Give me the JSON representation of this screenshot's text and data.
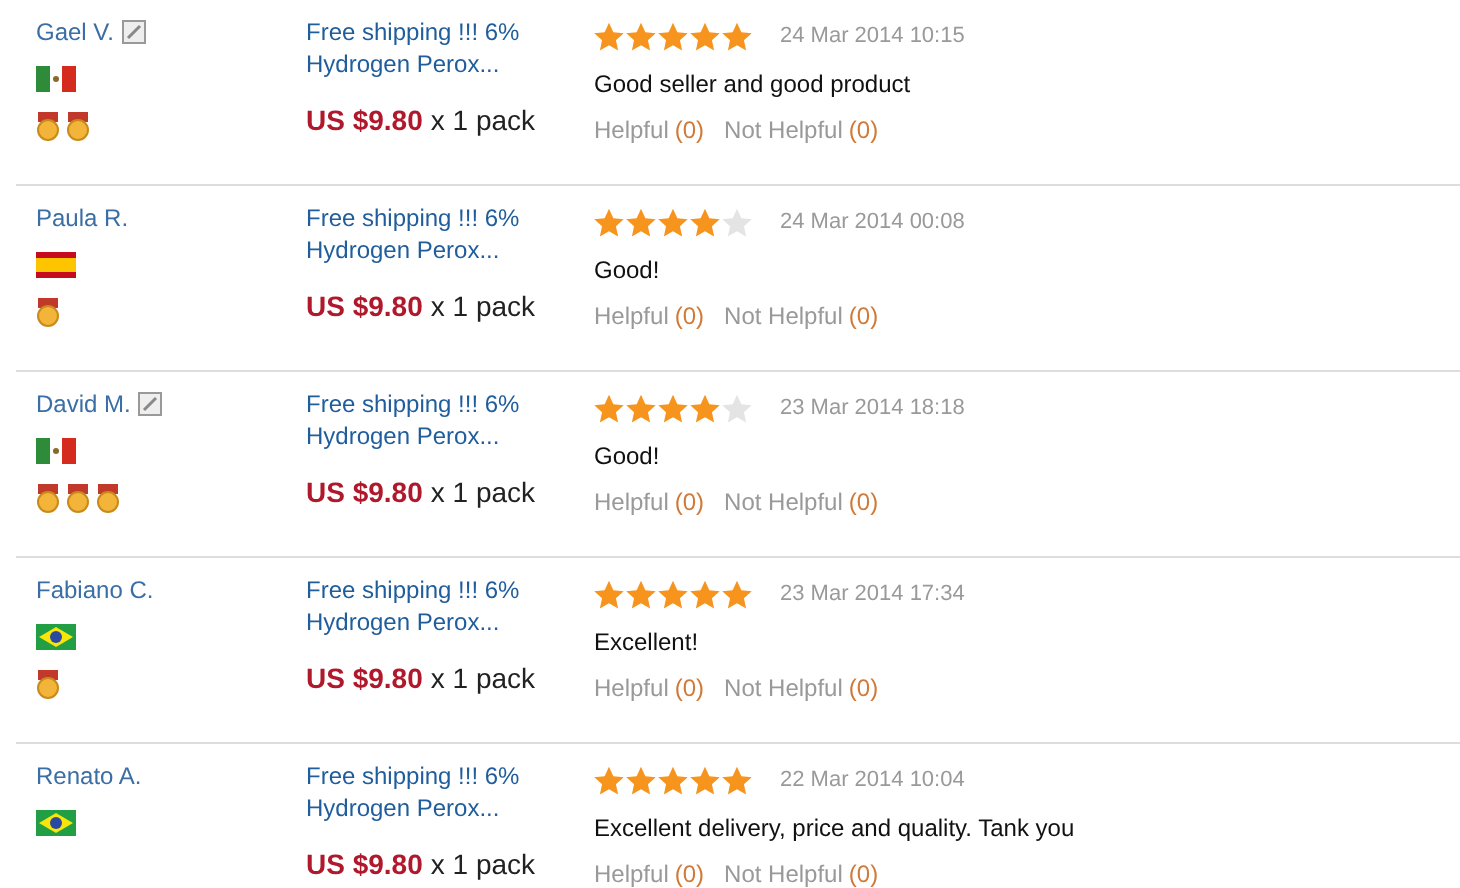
{
  "reviews": [
    {
      "name": "Gael V.",
      "edited": true,
      "flag": {
        "kind": "mexico"
      },
      "medals": [
        {
          "kind": "medal"
        },
        {
          "kind": "medal"
        }
      ],
      "product": "Free shipping !!! 6% Hydrogen Perox...",
      "price": "US $9.80",
      "quantity": "x 1 pack",
      "stars": 5,
      "date": "24 Mar 2014 10:15",
      "text": "Good seller and good product",
      "helpful": "Helpful",
      "helpful_count": "(0)",
      "not_helpful": "Not Helpful",
      "not_helpful_count": "(0)"
    },
    {
      "name": "Paula R.",
      "edited": false,
      "flag": {
        "kind": "spain"
      },
      "medals": [
        {
          "kind": "medal"
        }
      ],
      "product": "Free shipping !!! 6% Hydrogen Perox...",
      "price": "US $9.80",
      "quantity": "x 1 pack",
      "stars": 4,
      "date": "24 Mar 2014 00:08",
      "text": "Good!",
      "helpful": "Helpful",
      "helpful_count": "(0)",
      "not_helpful": "Not Helpful",
      "not_helpful_count": "(0)"
    },
    {
      "name": "David M.",
      "edited": true,
      "flag": {
        "kind": "mexico"
      },
      "medals": [
        {
          "kind": "medal"
        },
        {
          "kind": "medal"
        },
        {
          "kind": "medal"
        }
      ],
      "product": "Free shipping !!! 6% Hydrogen Perox...",
      "price": "US $9.80",
      "quantity": "x 1 pack",
      "stars": 4,
      "date": "23 Mar 2014 18:18",
      "text": "Good!",
      "helpful": "Helpful",
      "helpful_count": "(0)",
      "not_helpful": "Not Helpful",
      "not_helpful_count": "(0)"
    },
    {
      "name": "Fabiano C.",
      "edited": false,
      "flag": {
        "kind": "brazil"
      },
      "medals": [
        {
          "kind": "medal"
        }
      ],
      "product": "Free shipping !!! 6% Hydrogen Perox...",
      "price": "US $9.80",
      "quantity": "x 1 pack",
      "stars": 5,
      "date": "23 Mar 2014 17:34",
      "text": "Excellent!",
      "helpful": "Helpful",
      "helpful_count": "(0)",
      "not_helpful": "Not Helpful",
      "not_helpful_count": "(0)"
    },
    {
      "name": "Renato A.",
      "edited": false,
      "flag": {
        "kind": "brazil"
      },
      "product": "Free shipping !!! 6% Hydrogen Perox...",
      "price": "US $9.80",
      "quantity": "x 1 pack",
      "stars": 5,
      "date": "22 Mar 2014 10:04",
      "text": "Excellent delivery, price and quality. Tank you",
      "helpful": "Helpful",
      "helpful_count": "(0)",
      "not_helpful": "Not Helpful",
      "not_helpful_count": "(0)"
    }
  ]
}
